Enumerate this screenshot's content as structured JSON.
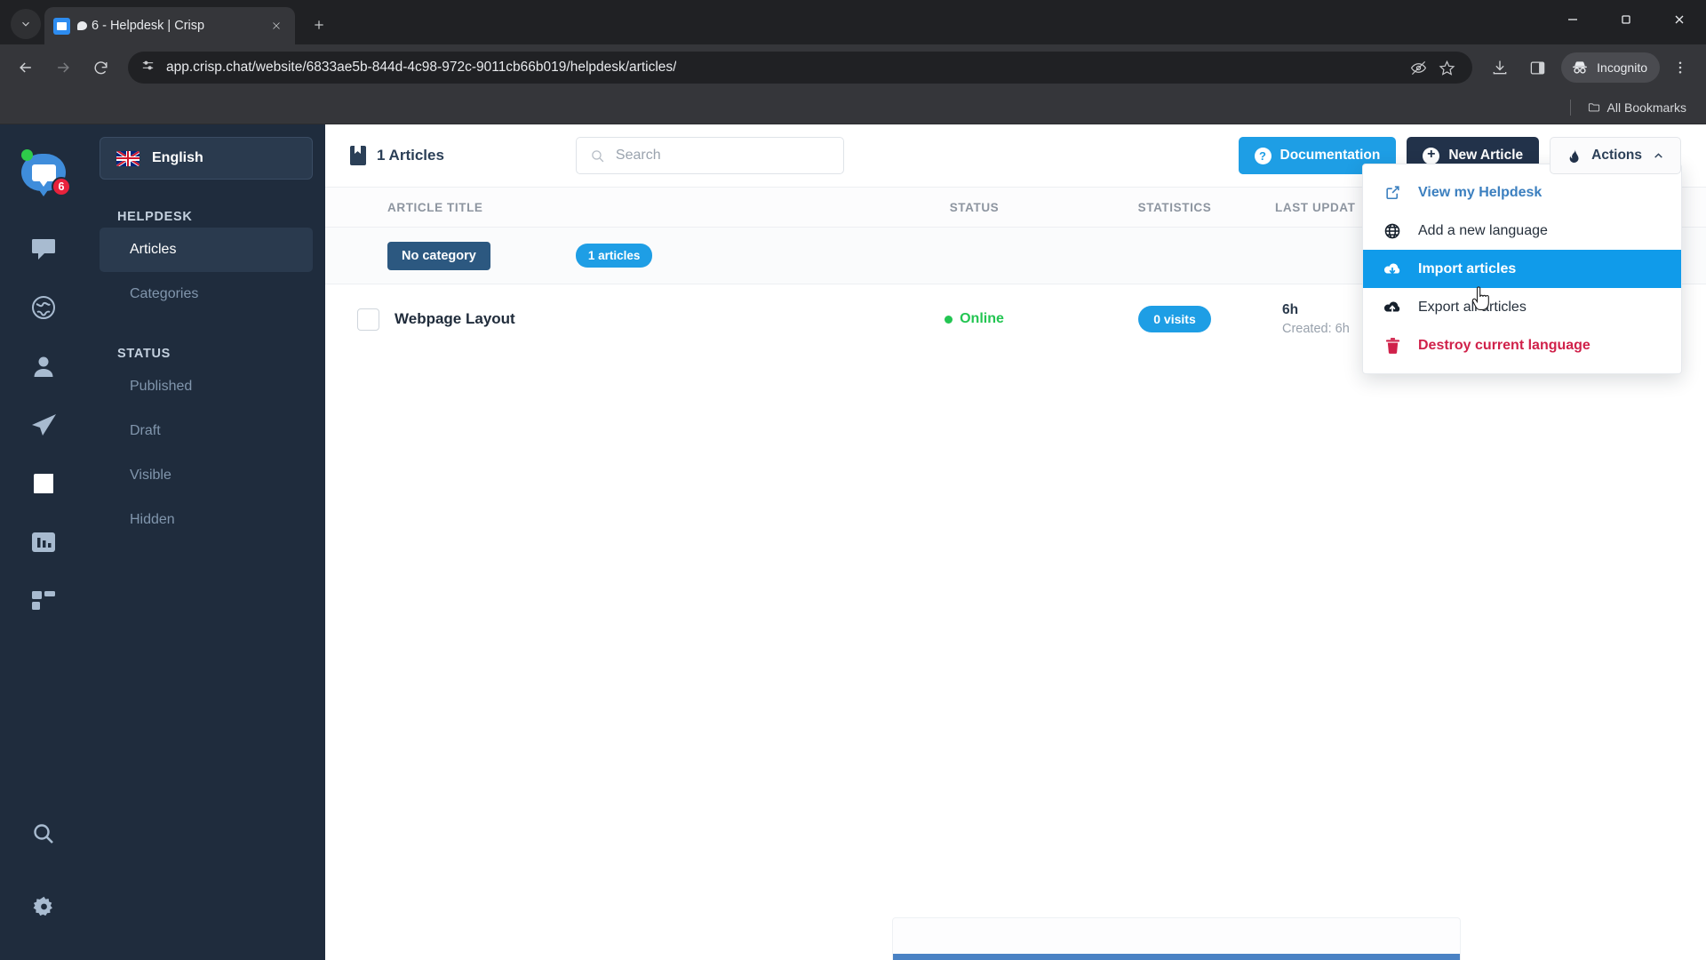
{
  "browser": {
    "tab": {
      "title": "6 - Helpdesk | Crisp",
      "favicon": "crisp-icon"
    },
    "new_tab_label": "+",
    "url": "app.crisp.chat/website/6833ae5b-844d-4c98-972c-9011cb66b019/helpdesk/articles/",
    "profile_label": "Incognito",
    "bookmarks_label": "All Bookmarks",
    "icons": {
      "tab_search": "chevron-down-icon",
      "back": "back-arrow-icon",
      "forward": "forward-arrow-icon",
      "reload": "reload-icon",
      "site_info": "site-settings-icon",
      "tracking": "eye-off-icon",
      "bookmark": "star-icon",
      "downloads": "download-icon",
      "sidepanel": "side-panel-icon",
      "menu": "three-dot-menu-icon",
      "minimize": "minimize-icon",
      "maximize": "maximize-icon",
      "close": "close-icon"
    }
  },
  "rail": {
    "logo": {
      "name": "crisp-logo",
      "badge": "6",
      "presence": "online"
    },
    "items": [
      {
        "name": "chat-icon",
        "label": "Chat"
      },
      {
        "name": "globe-icon",
        "label": "Website"
      },
      {
        "name": "contacts-icon",
        "label": "Contacts"
      },
      {
        "name": "campaigns-icon",
        "label": "Campaigns"
      },
      {
        "name": "helpdesk-icon",
        "label": "Helpdesk",
        "active": true
      },
      {
        "name": "analytics-icon",
        "label": "Analytics"
      },
      {
        "name": "plugins-icon",
        "label": "Plugins"
      }
    ],
    "bottom": [
      {
        "name": "search-icon",
        "label": "Search"
      },
      {
        "name": "gear-icon",
        "label": "Settings"
      }
    ]
  },
  "sidebar": {
    "language": {
      "label": "English",
      "flag": "uk-flag-icon"
    },
    "sections": [
      {
        "title": "HELPDESK",
        "items": [
          {
            "label": "Articles",
            "active": true
          },
          {
            "label": "Categories",
            "active": false
          }
        ]
      },
      {
        "title": "STATUS",
        "items": [
          {
            "label": "Published",
            "active": false
          },
          {
            "label": "Draft",
            "active": false
          },
          {
            "label": "Visible",
            "active": false
          },
          {
            "label": "Hidden",
            "active": false
          }
        ]
      }
    ]
  },
  "toolbar": {
    "count_label": "1 Articles",
    "count_icon": "bookmark-icon",
    "search_placeholder": "Search",
    "search_value": "",
    "documentation_label": "Documentation",
    "new_article_label": "New Article",
    "actions_label": "Actions"
  },
  "table": {
    "headers": {
      "title": "ARTICLE TITLE",
      "status": "STATUS",
      "statistics": "STATISTICS",
      "last_updated": "LAST UPDAT"
    },
    "group": {
      "category": "No category",
      "count": "1 articles"
    },
    "rows": [
      {
        "checked": false,
        "title": "Webpage Layout",
        "status": "Online",
        "status_color": "#23c552",
        "visits": "0 visits",
        "updated": "6h",
        "created": "Created: 6h"
      }
    ]
  },
  "dropdown": {
    "open": true,
    "items": [
      {
        "label": "View my Helpdesk",
        "icon": "external-link-icon",
        "style": "link"
      },
      {
        "label": "Add a new language",
        "icon": "globe-icon",
        "style": "plain"
      },
      {
        "label": "Import articles",
        "icon": "cloud-download-icon",
        "style": "selected"
      },
      {
        "label": "Export all articles",
        "icon": "cloud-upload-icon",
        "style": "plain"
      },
      {
        "label": "Destroy current language",
        "icon": "trash-icon",
        "style": "danger"
      }
    ]
  },
  "colors": {
    "accent": "#1e9ee5",
    "sidebar": "#1f2c3d",
    "dark_button": "#22324a",
    "danger": "#d0214a",
    "online": "#23c552",
    "selected_menu": "#109bea"
  }
}
